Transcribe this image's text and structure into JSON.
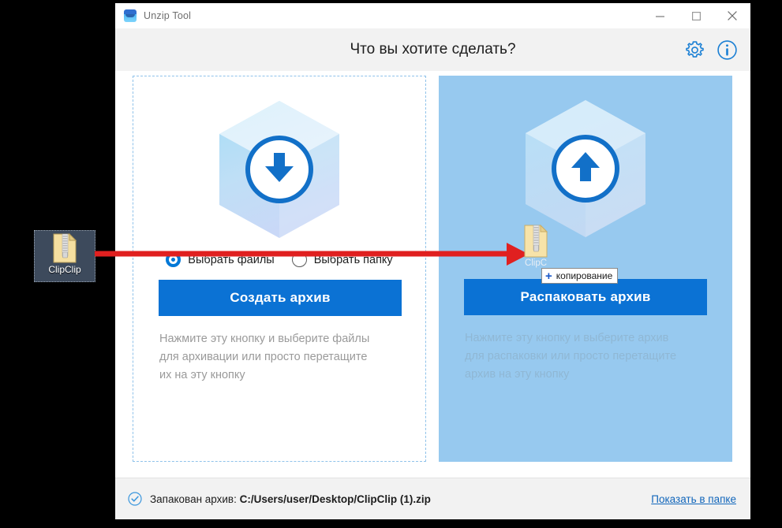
{
  "window": {
    "app_title": "Unzip Tool",
    "logo_icon": "unzip-tool-logo",
    "controls": {
      "minimize": "minimize-icon",
      "maximize": "maximize-icon",
      "close": "close-icon"
    }
  },
  "header": {
    "title": "Что вы хотите сделать?",
    "settings_icon": "gear-icon",
    "info_icon": "info-icon"
  },
  "panels": {
    "create": {
      "art_icon": "box-download-icon",
      "radios": [
        {
          "label": "Выбрать файлы",
          "selected": true
        },
        {
          "label": "Выбрать папку",
          "selected": false
        }
      ],
      "button_label": "Создать архив",
      "description": "Нажмите эту кнопку и выберите файлы\nдля архивации или просто перетащите\nих на эту кнопку"
    },
    "extract": {
      "art_icon": "box-upload-icon",
      "button_label": "Распаковать архив",
      "description": "Нажмите эту кнопку и выберите архив\nдля распаковки или просто перетащите\nархив на эту кнопку"
    }
  },
  "status": {
    "check_icon": "check-circle-icon",
    "label": "Запакован архив:",
    "path": "C:/Users/user/Desktop/ClipClip (1).zip",
    "link_label": "Показать в папке"
  },
  "desktop": {
    "icon": {
      "name": "ClipClip",
      "glyph": "zip-file-icon"
    }
  },
  "drag": {
    "file_label": "ClipC",
    "file_glyph": "zip-file-icon",
    "tooltip_plus": "+",
    "tooltip_text": "копирование",
    "arrow": "red-arrow-annotation"
  },
  "colors": {
    "accent_blue": "#0b72d4",
    "panel_blue": "#97c9ef",
    "dashed_border": "#8fc2ea",
    "link_blue": "#1166bb",
    "arrow_red": "#e02020"
  }
}
